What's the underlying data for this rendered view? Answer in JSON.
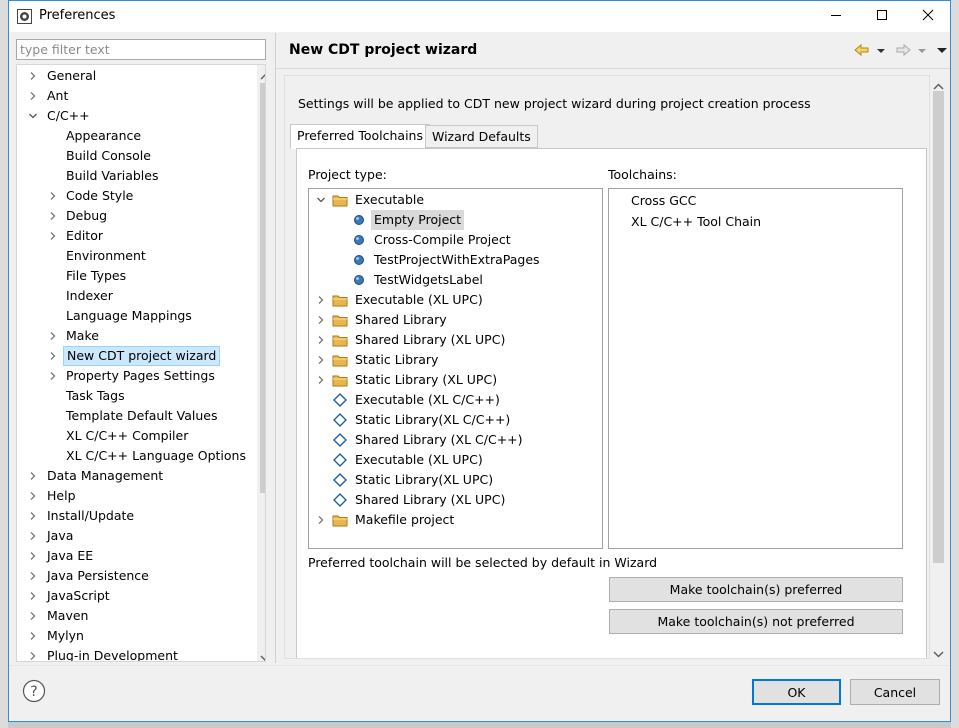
{
  "window": {
    "title": "Preferences",
    "controls": [
      "minimize-icon",
      "maximize-icon",
      "close-icon"
    ]
  },
  "filter": {
    "placeholder": "type filter text"
  },
  "sidebar": {
    "items": [
      {
        "label": "General",
        "level": 0,
        "arrow": "collapsed"
      },
      {
        "label": "Ant",
        "level": 0,
        "arrow": "collapsed"
      },
      {
        "label": "C/C++",
        "level": 0,
        "arrow": "expanded"
      },
      {
        "label": "Appearance",
        "level": 1,
        "arrow": "none"
      },
      {
        "label": "Build Console",
        "level": 1,
        "arrow": "none"
      },
      {
        "label": "Build Variables",
        "level": 1,
        "arrow": "none"
      },
      {
        "label": "Code Style",
        "level": 1,
        "arrow": "collapsed"
      },
      {
        "label": "Debug",
        "level": 1,
        "arrow": "collapsed"
      },
      {
        "label": "Editor",
        "level": 1,
        "arrow": "collapsed"
      },
      {
        "label": "Environment",
        "level": 1,
        "arrow": "none"
      },
      {
        "label": "File Types",
        "level": 1,
        "arrow": "none"
      },
      {
        "label": "Indexer",
        "level": 1,
        "arrow": "none"
      },
      {
        "label": "Language Mappings",
        "level": 1,
        "arrow": "none"
      },
      {
        "label": "Make",
        "level": 1,
        "arrow": "collapsed"
      },
      {
        "label": "New CDT project wizard",
        "level": 1,
        "arrow": "collapsed",
        "selected": true
      },
      {
        "label": "Property Pages Settings",
        "level": 1,
        "arrow": "collapsed"
      },
      {
        "label": "Task Tags",
        "level": 1,
        "arrow": "none"
      },
      {
        "label": "Template Default Values",
        "level": 1,
        "arrow": "none"
      },
      {
        "label": "XL C/C++ Compiler",
        "level": 1,
        "arrow": "none"
      },
      {
        "label": "XL C/C++ Language Options",
        "level": 1,
        "arrow": "none"
      },
      {
        "label": "Data Management",
        "level": 0,
        "arrow": "collapsed"
      },
      {
        "label": "Help",
        "level": 0,
        "arrow": "collapsed"
      },
      {
        "label": "Install/Update",
        "level": 0,
        "arrow": "collapsed"
      },
      {
        "label": "Java",
        "level": 0,
        "arrow": "collapsed"
      },
      {
        "label": "Java EE",
        "level": 0,
        "arrow": "collapsed"
      },
      {
        "label": "Java Persistence",
        "level": 0,
        "arrow": "collapsed"
      },
      {
        "label": "JavaScript",
        "level": 0,
        "arrow": "collapsed"
      },
      {
        "label": "Maven",
        "level": 0,
        "arrow": "collapsed"
      },
      {
        "label": "Mylyn",
        "level": 0,
        "arrow": "collapsed"
      },
      {
        "label": "Plug-in Development",
        "level": 0,
        "arrow": "collapsed"
      }
    ]
  },
  "page": {
    "title": "New CDT project wizard",
    "description": "Settings will be applied to CDT new project wizard during project creation process",
    "nav_icons": [
      "back-arrow-icon",
      "back-dropdown-icon",
      "forward-arrow-icon",
      "forward-dropdown-icon",
      "view-menu-icon"
    ]
  },
  "tabs": [
    {
      "label": "Preferred Toolchains",
      "active": true
    },
    {
      "label": "Wizard Defaults",
      "active": false
    }
  ],
  "project_type": {
    "label": "Project type:",
    "items": [
      {
        "label": "Executable",
        "icon": "folder",
        "level": 0,
        "arrow": "expanded"
      },
      {
        "label": "Empty Project",
        "icon": "ball",
        "level": 1,
        "arrow": "none",
        "selected": true
      },
      {
        "label": "Cross-Compile Project",
        "icon": "ball",
        "level": 1,
        "arrow": "none"
      },
      {
        "label": "TestProjectWithExtraPages",
        "icon": "ball",
        "level": 1,
        "arrow": "none"
      },
      {
        "label": "TestWidgetsLabel",
        "icon": "ball",
        "level": 1,
        "arrow": "none"
      },
      {
        "label": "Executable (XL UPC)",
        "icon": "folder",
        "level": 0,
        "arrow": "collapsed"
      },
      {
        "label": "Shared Library",
        "icon": "folder",
        "level": 0,
        "arrow": "collapsed"
      },
      {
        "label": "Shared Library (XL UPC)",
        "icon": "folder",
        "level": 0,
        "arrow": "collapsed"
      },
      {
        "label": "Static Library",
        "icon": "folder",
        "level": 0,
        "arrow": "collapsed"
      },
      {
        "label": "Static Library (XL UPC)",
        "icon": "folder",
        "level": 0,
        "arrow": "collapsed"
      },
      {
        "label": "Executable (XL C/C++)",
        "icon": "diamond",
        "level": 0,
        "arrow": "none"
      },
      {
        "label": "Static Library(XL C/C++)",
        "icon": "diamond",
        "level": 0,
        "arrow": "none"
      },
      {
        "label": "Shared Library (XL C/C++)",
        "icon": "diamond",
        "level": 0,
        "arrow": "none"
      },
      {
        "label": "Executable (XL UPC)",
        "icon": "diamond",
        "level": 0,
        "arrow": "none"
      },
      {
        "label": "Static Library(XL UPC)",
        "icon": "diamond",
        "level": 0,
        "arrow": "none"
      },
      {
        "label": "Shared Library (XL UPC)",
        "icon": "diamond",
        "level": 0,
        "arrow": "none"
      },
      {
        "label": "Makefile project",
        "icon": "folder",
        "level": 0,
        "arrow": "collapsed"
      }
    ]
  },
  "toolchains": {
    "label": "Toolchains:",
    "items": [
      "Cross GCC",
      "XL C/C++ Tool Chain"
    ]
  },
  "hint": "Preferred toolchain will be selected by default in Wizard",
  "buttons": {
    "make_preferred": "Make toolchain(s) preferred",
    "make_not_preferred": "Make toolchain(s) not preferred",
    "ok": "OK",
    "cancel": "Cancel"
  },
  "colors": {
    "selection": "#cce8ff",
    "folder": "#e8b64a",
    "ball": "#3a78b8",
    "diamond": "#1f5fa8",
    "focus": "#0078d7"
  }
}
